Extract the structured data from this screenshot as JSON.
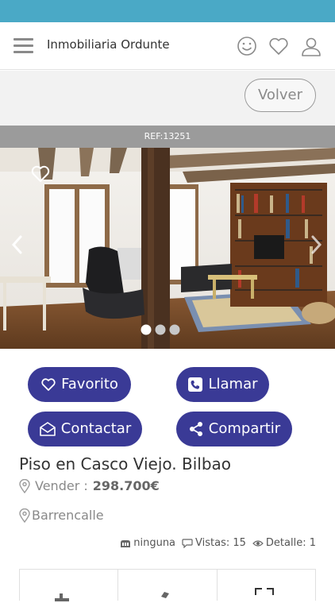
{
  "app": {
    "title": "Inmobiliaria Ordunte"
  },
  "subbar": {
    "back_label": "Volver"
  },
  "listing": {
    "ref": "REF:13251",
    "title": "Piso en Casco Viejo. Bilbao",
    "operation_label": "Vender :",
    "price": "298.700€",
    "location": "Barrencalle",
    "stats": {
      "heating": "ninguna",
      "views_label": "Vistas: 15",
      "detail_label": "Detalle: 1"
    }
  },
  "gallery": {
    "dots_total": 3,
    "active_dot": 1
  },
  "actions": {
    "favorito": "Favorito",
    "llamar": "Llamar",
    "contactar": "Contactar",
    "compartir": "Compartir"
  },
  "colors": {
    "status_bar": "#4aa9c6",
    "button": "#3a3a96",
    "ref_bar": "#9b9b9b"
  },
  "icons": [
    "menu-icon",
    "smiley-icon",
    "heart-icon",
    "user-icon",
    "chevron-left-icon",
    "chevron-right-icon",
    "phone-icon",
    "envelope-icon",
    "share-icon",
    "pin-icon",
    "tag-icon",
    "speech-bubble-icon",
    "eye-icon",
    "heating-icon"
  ]
}
